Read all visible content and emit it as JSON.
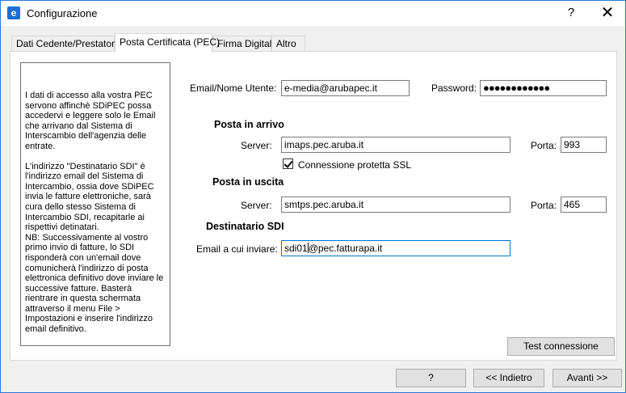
{
  "window": {
    "title": "Configurazione",
    "app_icon": "e",
    "help_label": "?",
    "close_label": "✕"
  },
  "tabs": [
    {
      "label": "Dati Cedente/Prestatore"
    },
    {
      "label": "Posta Certificata (PEC)",
      "active": true
    },
    {
      "label": "Firma Digitale"
    },
    {
      "label": "Altro"
    }
  ],
  "info": {
    "p1": "I dati di accesso alla vostra PEC servono affinchè SDiPEC possa accedervi e leggere solo le Email che arrivano dal Sistema di Interscambio dell'agenzia delle entrate.",
    "p2": "L'indirizzo \"Destinatario SDI\" è l'indirizzo email del Sistema di Intercambio, ossia dove SDiPEC invia le fatture elettroniche, sarà cura dello stesso Sistema di Intercambio SDI, recapitarle ai rispettivi detinatari.",
    "p3": "NB: Successivamente al vostro primo invio di fatture, lo SDI risponderà con un'email dove comunicherà l'indirizzo di posta elettronica definitivo dove inviare le successive fatture. Basterà rientrare in questa schermata attraverso il menu File > Impostazioni e inserire l'indirizzo email definitivo."
  },
  "account": {
    "email_label": "Email/Nome Utente:",
    "email_value": "e-media@arubapec.it",
    "password_label": "Password:",
    "password_value": "●●●●●●●●●●●●"
  },
  "incoming": {
    "title": "Posta in arrivo",
    "server_label": "Server:",
    "server_value": "imaps.pec.aruba.it",
    "port_label": "Porta:",
    "port_value": "993",
    "ssl_label": "Connessione protetta SSL",
    "ssl_checked": true
  },
  "outgoing": {
    "title": "Posta in uscita",
    "server_label": "Server:",
    "server_value": "smtps.pec.aruba.it",
    "port_label": "Porta:",
    "port_value": "465"
  },
  "sdi": {
    "title": "Destinatario SDI",
    "email_label": "Email a cui inviare:",
    "email_before_caret": "sdi01",
    "email_after_caret": "@pec.fatturapa.it"
  },
  "buttons": {
    "test": "Test connessione",
    "help": "?",
    "back": "<< Indietro",
    "next": "Avanti >>"
  }
}
